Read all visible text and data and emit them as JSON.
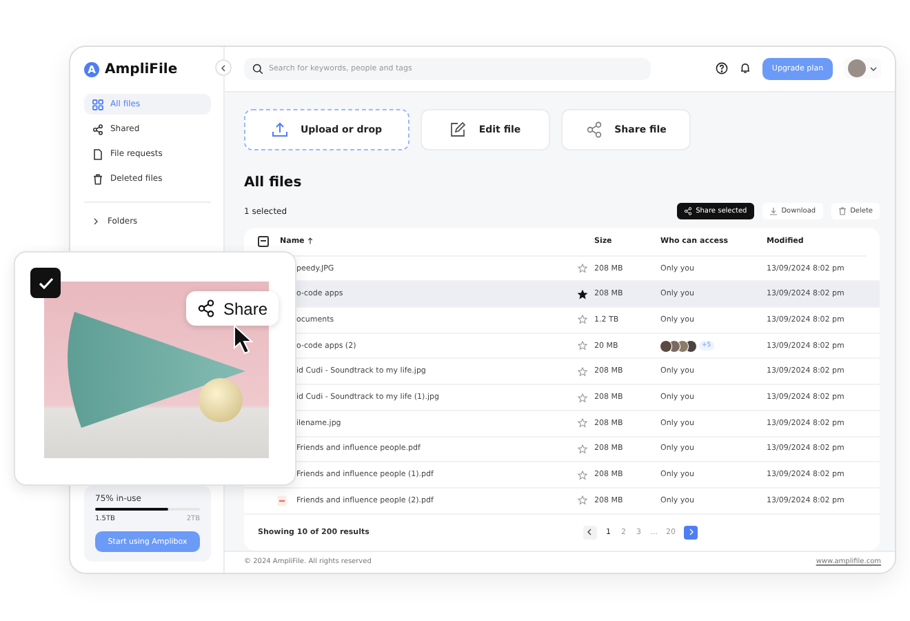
{
  "brand": {
    "mark": "A",
    "name": "AmpliFile"
  },
  "sidebar": {
    "nav": [
      {
        "label": "All files",
        "selected": true
      },
      {
        "label": "Shared",
        "selected": false
      },
      {
        "label": "File requests",
        "selected": false
      },
      {
        "label": "Deleted files",
        "selected": false
      }
    ],
    "folders": {
      "label": "Folders",
      "expanded": false
    },
    "storage": {
      "usage": "75% in-use",
      "level": 0.7,
      "used": "1.5TB",
      "total": "2TB",
      "button": "Start using Amplibox"
    }
  },
  "topbar": {
    "search_placeholder": "Search for keywords, people and tags",
    "upgrade_button": "Upgrade plan"
  },
  "quick_actions": [
    {
      "label": "Upload or drop",
      "kind": "upload"
    },
    {
      "label": "Edit file",
      "kind": "edit"
    },
    {
      "label": "Share file",
      "kind": "share"
    }
  ],
  "section_title": "All files",
  "selection_count": "1 selected",
  "bulk_actions": [
    {
      "label": "Share selected",
      "kind": "share",
      "primary": true
    },
    {
      "label": "Download",
      "kind": "download",
      "primary": false
    },
    {
      "label": "Delete",
      "kind": "delete",
      "primary": false
    }
  ],
  "table": {
    "select_all": {
      "indeterminate": true
    },
    "columns": [
      {
        "label": "Name",
        "sorted": true
      },
      {
        "label": "Size",
        "sorted": false
      },
      {
        "label": "Who can access",
        "sorted": false
      },
      {
        "label": "Modified",
        "sorted": false
      }
    ],
    "rows": [
      {
        "name": "peedy.JPG",
        "starred": false,
        "selected": false,
        "size": "208 MB",
        "kind": "text",
        "access": "Only you",
        "modified": "13/09/2024 8:02 pm"
      },
      {
        "name": "o-code apps",
        "starred": true,
        "selected": true,
        "size": "208 MB",
        "kind": "text",
        "access": "Only you",
        "modified": "13/09/2024 8:02 pm"
      },
      {
        "name": "ocuments",
        "starred": false,
        "selected": false,
        "size": "1.2 TB",
        "kind": "text",
        "access": "Only you",
        "modified": "13/09/2024 8:02 pm"
      },
      {
        "name": "o-code apps (2)",
        "starred": false,
        "selected": false,
        "size": "20 MB",
        "kind": "avatars",
        "access": "+5",
        "modified": "13/09/2024 8:02 pm"
      },
      {
        "name": "id Cudi - Soundtrack to my life.jpg",
        "starred": false,
        "selected": false,
        "size": "208 MB",
        "kind": "text",
        "access": "Only you",
        "modified": "13/09/2024 8:02 pm"
      },
      {
        "name": "id Cudi - Soundtrack to my life (1).jpg",
        "starred": false,
        "selected": false,
        "size": "208 MB",
        "kind": "text",
        "access": "Only you",
        "modified": "13/09/2024 8:02 pm"
      },
      {
        "name": "ilename.jpg",
        "starred": false,
        "selected": false,
        "size": "208 MB",
        "kind": "text",
        "access": "Only you",
        "modified": "13/09/2024 8:02 pm"
      },
      {
        "name": "Friends and influence people.pdf",
        "starred": false,
        "selected": false,
        "size": "208 MB",
        "kind": "text",
        "access": "Only you",
        "modified": "13/09/2024 8:02 pm"
      },
      {
        "name": "Friends and influence people (1).pdf",
        "starred": false,
        "selected": false,
        "size": "208 MB",
        "kind": "text",
        "access": "Only you",
        "modified": "13/09/2024 8:02 pm"
      },
      {
        "name": "Friends and influence people (2).pdf",
        "starred": false,
        "selected": false,
        "size": "208 MB",
        "kind": "pdf",
        "access": "Only you",
        "modified": "13/09/2024 8:02 pm"
      }
    ]
  },
  "pagination": {
    "summary": "Showing 10 of 200 results",
    "pages": [
      {
        "label": "1",
        "selected": true
      },
      {
        "label": "2",
        "selected": false
      },
      {
        "label": "3",
        "selected": false
      },
      {
        "label": "...",
        "selected": false
      },
      {
        "label": "20",
        "selected": false
      }
    ]
  },
  "footer": {
    "copyright": "© 2024 AmpliFile. All rights reserved",
    "website": "www.amplifile.com"
  },
  "share_card": {
    "checked": true,
    "action": "Share"
  }
}
